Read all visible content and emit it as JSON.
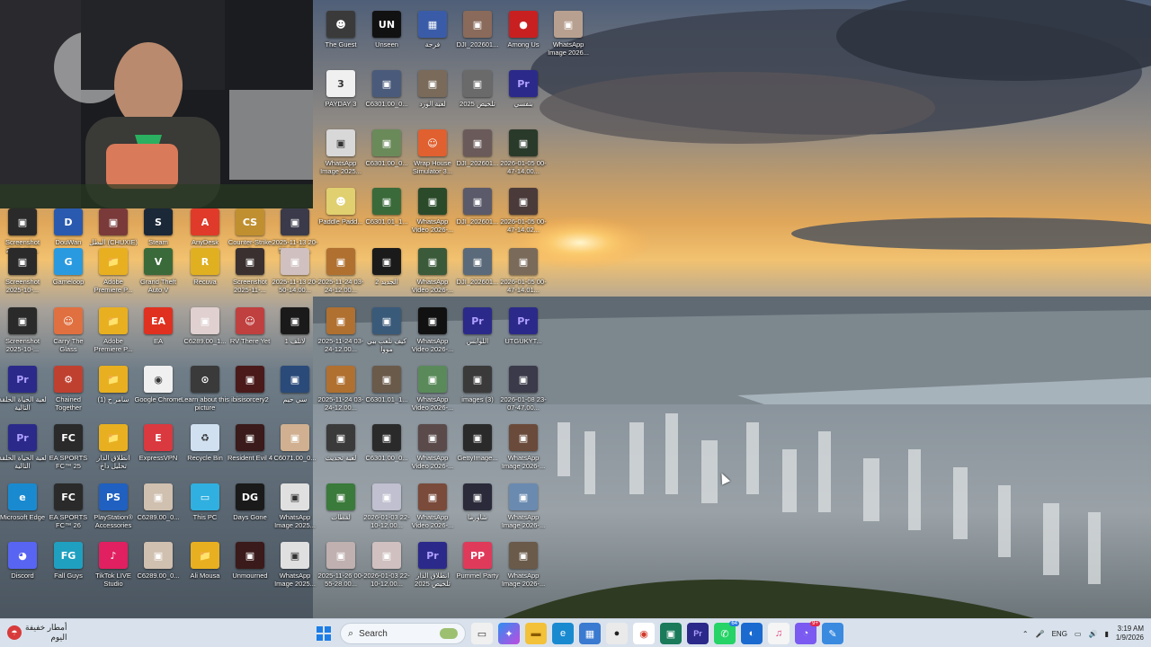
{
  "desktop": {
    "icons": [
      {
        "label": "The Guest",
        "color": "#3a3a3a",
        "glyph": "☻"
      },
      {
        "label": "Unseen",
        "color": "#111111",
        "glyph": "UN"
      },
      {
        "label": "فرجة",
        "color": "#3a5ca8",
        "glyph": "▦"
      },
      {
        "label": "DJI_202601...",
        "color": "#8a6a5a",
        "glyph": "▣"
      },
      {
        "label": "Among Us",
        "color": "#c82020",
        "glyph": "●"
      },
      {
        "label": "WhatsApp Image 2026...",
        "color": "#b8a090",
        "glyph": "▣"
      },
      {
        "label": "PAYDAY 3",
        "color": "#f0f0f0",
        "glyph": "3"
      },
      {
        "label": "C6301.00_0...",
        "color": "#4a5a7a",
        "glyph": "▣"
      },
      {
        "label": "لعبة الورد",
        "color": "#7a6a5a",
        "glyph": "▣"
      },
      {
        "label": "تلخيص 2025",
        "color": "#6a6a6a",
        "glyph": "▣"
      },
      {
        "label": "بنفسي",
        "color": "#2b2a8a",
        "glyph": "Pr"
      },
      {
        "label": "WhatsApp Image 2025...",
        "color": "#d8d8d8",
        "glyph": "▣"
      },
      {
        "label": "C6301.00_0...",
        "color": "#6a8a5a",
        "glyph": "▣"
      },
      {
        "label": "Wrap House Simulator 3...",
        "color": "#e06030",
        "glyph": "☺"
      },
      {
        "label": "DJI_202601...",
        "color": "#6a5a5a",
        "glyph": "▣"
      },
      {
        "label": "2026-01-05 00-47-14.00...",
        "color": "#2a3a2a",
        "glyph": "▣"
      },
      {
        "label": "Paddle Padd...",
        "color": "#e0d070",
        "glyph": "☻"
      },
      {
        "label": "C6301.01_1...",
        "color": "#3a6a3a",
        "glyph": "▣"
      },
      {
        "label": "WhatsApp Video 2026-...",
        "color": "#2a4a2a",
        "glyph": "▣"
      },
      {
        "label": "DJI_202601...",
        "color": "#5a5a6a",
        "glyph": "▣"
      },
      {
        "label": "2026-01-05 00-47-14.02...",
        "color": "#4a3a3a",
        "glyph": "▣"
      },
      {
        "label": "Screenshot 2025-10-...",
        "color": "#2a2a2a",
        "glyph": "▣"
      },
      {
        "label": "DouWan",
        "color": "#2a5ab0",
        "glyph": "D"
      },
      {
        "label": "البطل (CHUXIE)",
        "color": "#7a3a3a",
        "glyph": "▣"
      },
      {
        "label": "Steam",
        "color": "#1b2838",
        "glyph": "S"
      },
      {
        "label": "AnyDesk",
        "color": "#e03a2a",
        "glyph": "A"
      },
      {
        "label": "Counter-Strike 2",
        "color": "#c09030",
        "glyph": "CS"
      },
      {
        "label": "2025-11-13 20-50-14.00...",
        "color": "#3a3a4a",
        "glyph": "▣"
      },
      {
        "label": "Screenshot 2025-10-...",
        "color": "#2a2a2a",
        "glyph": "▣"
      },
      {
        "label": "Gameloop",
        "color": "#2a9ae0",
        "glyph": "G"
      },
      {
        "label": "Adobe Premiere P...",
        "color": "#e8b020",
        "glyph": "📁"
      },
      {
        "label": "Grand Theft Auto V",
        "color": "#3a6a3a",
        "glyph": "V"
      },
      {
        "label": "Recuva",
        "color": "#e0b020",
        "glyph": "R"
      },
      {
        "label": "Screenshot 2025-11-...",
        "color": "#3a3030",
        "glyph": "▣"
      },
      {
        "label": "2025-11-13 20-50-14.00...",
        "color": "#d0c0c0",
        "glyph": "▣"
      },
      {
        "label": "2025-11-24 03-24-12.00...",
        "color": "#b07030",
        "glyph": "▣"
      },
      {
        "label": "الجديد 2",
        "color": "#1a1a1a",
        "glyph": "▣"
      },
      {
        "label": "WhatsApp Video 2026-...",
        "color": "#3a5a3a",
        "glyph": "▣"
      },
      {
        "label": "DJI_202601...",
        "color": "#5a6a7a",
        "glyph": "▣"
      },
      {
        "label": "2026-01-05 00-47-14.01...",
        "color": "#7a6a5a",
        "glyph": "▣"
      },
      {
        "label": "Screenshot 2025-10-...",
        "color": "#2a2a2a",
        "glyph": "▣"
      },
      {
        "label": "Carry The Glass",
        "color": "#e07040",
        "glyph": "☺"
      },
      {
        "label": "Adobe Premiere P...",
        "color": "#e8b020",
        "glyph": "📁"
      },
      {
        "label": "EA",
        "color": "#e03020",
        "glyph": "EA"
      },
      {
        "label": "C6289.00_1...",
        "color": "#e0d0d0",
        "glyph": "▣"
      },
      {
        "label": "RV There Yet",
        "color": "#c04040",
        "glyph": "☺"
      },
      {
        "label": "لاتلف 1",
        "color": "#1a1a1a",
        "glyph": "▣"
      },
      {
        "label": "2025-11-24 03-24-12.00...",
        "color": "#b07030",
        "glyph": "▣"
      },
      {
        "label": "كيف تلعب ببي مووا",
        "color": "#3a5a7a",
        "glyph": "▣"
      },
      {
        "label": "WhatsApp Video 2026-...",
        "color": "#111111",
        "glyph": "▣"
      },
      {
        "label": "اللوابس",
        "color": "#2b2a8a",
        "glyph": "Pr"
      },
      {
        "label": "UTGUKYT...",
        "color": "#2b2a8a",
        "glyph": "Pr"
      },
      {
        "label": "لعبة الحياة الحلقة التالية",
        "color": "#2b2a8a",
        "glyph": "Pr"
      },
      {
        "label": "Chained Together",
        "color": "#c04030",
        "glyph": "⚙"
      },
      {
        "label": "(1) سامر ج",
        "color": "#e8b020",
        "glyph": "📁"
      },
      {
        "label": "Google Chrome",
        "color": "#f0f0f0",
        "glyph": "◉"
      },
      {
        "label": "Learn about this picture",
        "color": "#3a3a3a",
        "glyph": "⊙"
      },
      {
        "label": "ibisisorcery2",
        "color": "#4a1a1a",
        "glyph": "▣"
      },
      {
        "label": "سي حيم",
        "color": "#2a4a7a",
        "glyph": "▣"
      },
      {
        "label": "2025-11-24 03-24-12.00...",
        "color": "#b07030",
        "glyph": "▣"
      },
      {
        "label": "C6301.01_1...",
        "color": "#6a5a4a",
        "glyph": "▣"
      },
      {
        "label": "WhatsApp Video 2026-...",
        "color": "#5a8a5a",
        "glyph": "▣"
      },
      {
        "label": "images (3)",
        "color": "#3a3a3a",
        "glyph": "▣"
      },
      {
        "label": "2026-01-08 23-07-47.00...",
        "color": "#3a3a4a",
        "glyph": "▣"
      },
      {
        "label": "لعبة الحياة الحلقة التالية",
        "color": "#2b2a8a",
        "glyph": "Pr"
      },
      {
        "label": "EA SPORTS FC™ 25",
        "color": "#2a2a2a",
        "glyph": "FC"
      },
      {
        "label": "انطلاق الدار تحليل داخ",
        "color": "#e8b020",
        "glyph": "📁"
      },
      {
        "label": "ExpressVPN",
        "color": "#da3940",
        "glyph": "E"
      },
      {
        "label": "Recycle Bin",
        "color": "#d0e0f0",
        "glyph": "♻"
      },
      {
        "label": "Resident Evil 4",
        "color": "#3a1a1a",
        "glyph": "▣"
      },
      {
        "label": "C6071.00_0...",
        "color": "#d0b090",
        "glyph": "▣"
      },
      {
        "label": "لعبة تحديث",
        "color": "#3a3a3a",
        "glyph": "▣"
      },
      {
        "label": "C6301.00_0...",
        "color": "#2a2a2a",
        "glyph": "▣"
      },
      {
        "label": "WhatsApp Video 2026-...",
        "color": "#5a4a4a",
        "glyph": "▣"
      },
      {
        "label": "GettyImage...",
        "color": "#2a2a2a",
        "glyph": "▣"
      },
      {
        "label": "WhatsApp Image 2026-...",
        "color": "#6a4a3a",
        "glyph": "▣"
      },
      {
        "label": "Microsoft Edge",
        "color": "#1a8ad0",
        "glyph": "e"
      },
      {
        "label": "EA SPORTS FC™ 26",
        "color": "#2a2a2a",
        "glyph": "FC"
      },
      {
        "label": "PlayStation® Accessories",
        "color": "#2060c0",
        "glyph": "PS"
      },
      {
        "label": "C6289.00_0...",
        "color": "#d0c0b0",
        "glyph": "▣"
      },
      {
        "label": "This PC",
        "color": "#30b0e0",
        "glyph": "▭"
      },
      {
        "label": "Days Gone",
        "color": "#1a1a1a",
        "glyph": "DG"
      },
      {
        "label": "WhatsApp Image 2025...",
        "color": "#e0e0e0",
        "glyph": "▣"
      },
      {
        "label": "لقطات",
        "color": "#3a7a3a",
        "glyph": "▣"
      },
      {
        "label": "2026-01-03 22-10-12.00...",
        "color": "#c0c0d0",
        "glyph": "▣"
      },
      {
        "label": "WhatsApp Video 2026-...",
        "color": "#7a4a3a",
        "glyph": "▣"
      },
      {
        "label": "شاورما",
        "color": "#2a2a3a",
        "glyph": "▣"
      },
      {
        "label": "WhatsApp Image 2026-...",
        "color": "#6a8ab0",
        "glyph": "▣"
      },
      {
        "label": "Discord",
        "color": "#5865f2",
        "glyph": "◕"
      },
      {
        "label": "Fall Guys",
        "color": "#20a0c0",
        "glyph": "FG"
      },
      {
        "label": "TikTok LIVE Studio",
        "color": "#e02060",
        "glyph": "♪"
      },
      {
        "label": "C6289.00_0...",
        "color": "#d0c0b0",
        "glyph": "▣"
      },
      {
        "label": "Ali Mousa",
        "color": "#e8b020",
        "glyph": "📁"
      },
      {
        "label": "Unmourned",
        "color": "#3a1a1a",
        "glyph": "▣"
      },
      {
        "label": "WhatsApp Image 2025...",
        "color": "#e0e0e0",
        "glyph": "▣"
      },
      {
        "label": "2025-11-26 00-55-28.00...",
        "color": "#c0b0b0",
        "glyph": "▣"
      },
      {
        "label": "2026-01-03 22-10-12.00...",
        "color": "#d0c0c0",
        "glyph": "▣"
      },
      {
        "label": "انطلاق الدار تلخيص 2025",
        "color": "#2b2a8a",
        "glyph": "Pr"
      },
      {
        "label": "Pummel Party",
        "color": "#e03a5a",
        "glyph": "PP"
      },
      {
        "label": "WhatsApp Image 2026-...",
        "color": "#6a5a4a",
        "glyph": "▣"
      }
    ]
  },
  "taskbar": {
    "weather": {
      "line1": "أمطار خفيفة",
      "line2": "اليوم",
      "icon": "rain-icon"
    },
    "search_placeholder": "Search",
    "apps": [
      "file-explorer-icon",
      "copilot-icon",
      "folder-icon",
      "edge-icon",
      "store-icon",
      "media-icon",
      "chrome-icon",
      "capture-icon",
      "premiere-icon",
      "whatsapp-icon",
      "app-icon",
      "music-icon",
      "messenger-icon",
      "editor-icon"
    ],
    "whatsapp_badge": "64",
    "messenger_badge": "9+",
    "language": "ENG",
    "time": "3:19 AM",
    "date": "1/9/2026"
  }
}
